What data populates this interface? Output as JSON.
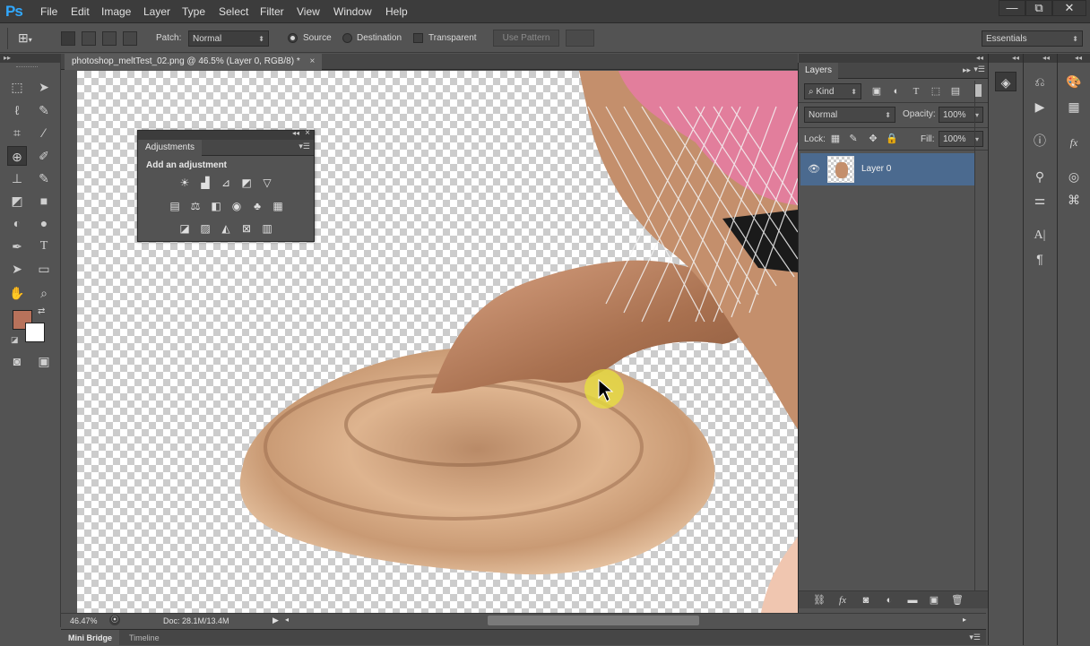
{
  "app": {
    "logo": "Ps"
  },
  "menu": [
    "File",
    "Edit",
    "Image",
    "Layer",
    "Type",
    "Select",
    "Filter",
    "View",
    "Window",
    "Help"
  ],
  "window_controls": {
    "minimize": "—",
    "restore": "⧉",
    "close": "✕"
  },
  "options_bar": {
    "patch_label": "Patch:",
    "patch_mode": "Normal",
    "source_label": "Source",
    "destination_label": "Destination",
    "transparent_label": "Transparent",
    "use_pattern_label": "Use Pattern",
    "workspace": "Essentials",
    "selected_radio": "Source"
  },
  "document": {
    "tab_title": "photoshop_meltTest_02.png @ 46.5% (Layer 0, RGB/8) *",
    "tab_close": "×"
  },
  "adjustments_panel": {
    "tab": "Adjustments",
    "heading": "Add an adjustment",
    "collapse": "◂◂",
    "close": "×"
  },
  "status_bar": {
    "zoom": "46.47%",
    "doc_info": "Doc: 28.1M/13.4M"
  },
  "bottom_tabs": [
    "Mini Bridge",
    "Timeline"
  ],
  "layers_panel": {
    "tab": "Layers",
    "filter_kind": "Kind",
    "blend_mode": "Normal",
    "opacity_label": "Opacity:",
    "opacity": "100%",
    "lock_label": "Lock:",
    "fill_label": "Fill:",
    "fill": "100%",
    "layers": [
      {
        "name": "Layer 0",
        "visible": true
      }
    ]
  },
  "colors": {
    "foreground": "#b8725b",
    "background": "#ffffff",
    "selected_layer": "#4b6a8f",
    "accent": "#31a8ff"
  }
}
